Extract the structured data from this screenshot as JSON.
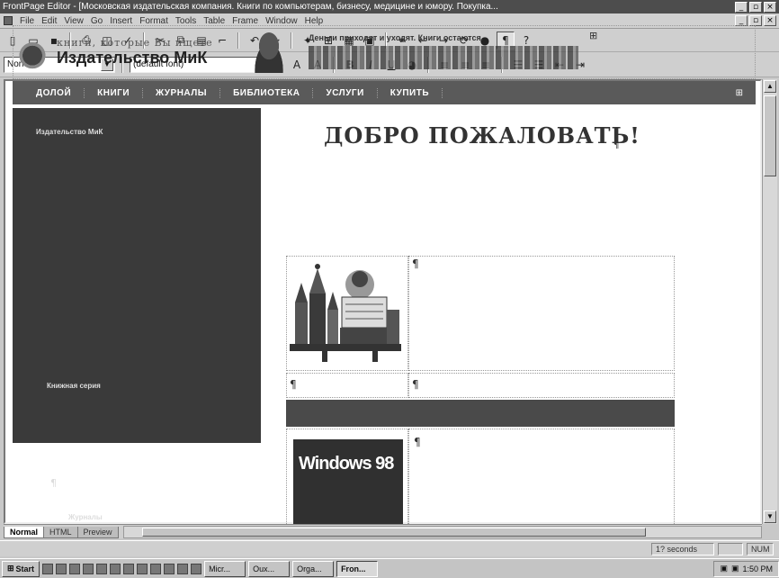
{
  "window": {
    "title": "FrontPage Editor - [Московская издательская компания. Книги по компьютерам, бизнесу, медицине и юмору. Покупка...",
    "min_icon": "minimize-icon",
    "max_icon": "maximize-icon",
    "close_icon": "close-icon"
  },
  "menu": [
    "File",
    "Edit",
    "View",
    "Go",
    "Insert",
    "Format",
    "Tools",
    "Table",
    "Frame",
    "Window",
    "Help"
  ],
  "format_toolbar": {
    "style_value": "Normal",
    "font_value": "(default font)"
  },
  "page": {
    "tagline": "книги, которые Вы ищете",
    "publisher": "Издательство МиК",
    "slogan": "Деньги приходят и уходят. Книги остаются.",
    "nav": [
      "ДОЛОЙ",
      "КНИГИ",
      "ЖУРНАЛЫ",
      "БИБЛИОТЕКА",
      "УСЛУГИ",
      "КУПИТЬ"
    ],
    "sidebar_labels": [
      "Издательство МиК",
      "Книжная серия",
      "Журналы"
    ],
    "welcome": "ДОБРО ПОЖАЛОВАТЬ!",
    "pilcrow": "¶",
    "book_title": "Windows 98"
  },
  "view_tabs": [
    "Normal",
    "HTML",
    "Preview"
  ],
  "status": {
    "time_estimate": "1? seconds",
    "num_indicator": "NUM"
  },
  "taskbar": {
    "start": "Start",
    "tasks": [
      "Micr...",
      "Oux...",
      "Orga...",
      "Fron..."
    ],
    "clock": "1:50 PM",
    "active_task_index": 3
  },
  "colors": {
    "title_bar": "#4d4d4d",
    "nav_bar": "#5a5a5a",
    "sidebar": "#3a3a3a"
  }
}
